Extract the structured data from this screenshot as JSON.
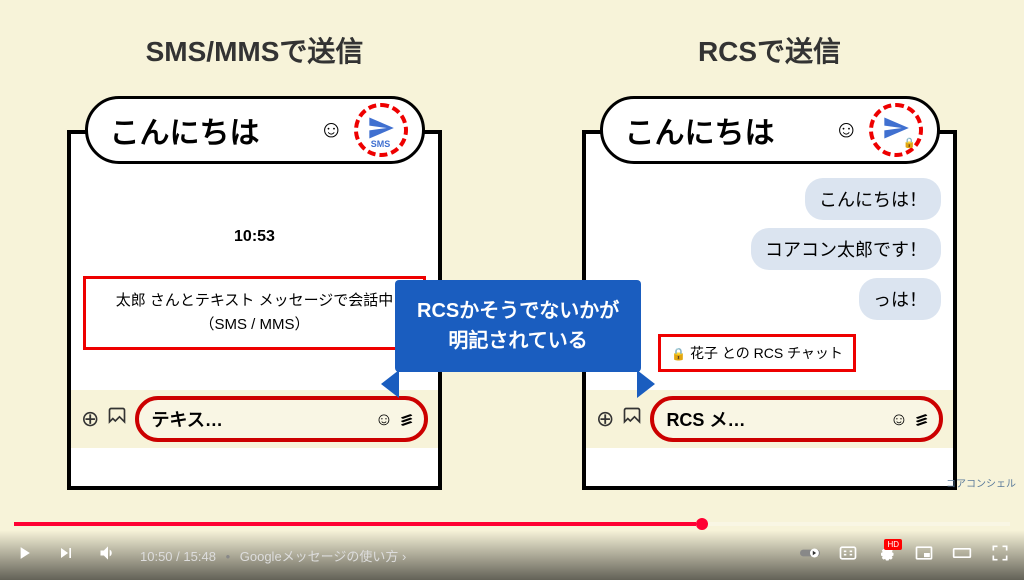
{
  "left": {
    "header": "SMS/MMSで送信",
    "inputText": "こんにちは",
    "sendLabel": "SMS",
    "timestamp": "10:53",
    "statusBox": "太郎 さんとテキスト メッセージで会話中（SMS / MMS）",
    "bottomInput": "テキス…"
  },
  "right": {
    "header": "RCSで送信",
    "inputText": "こんにちは",
    "msg1": "こんにちは！",
    "msg2": "コアコン太郎です！",
    "msg3": "っは！",
    "statusBox": "花子 との RCS チャット",
    "bottomInput": "RCS メ…"
  },
  "annotation": {
    "line1": "RCSかそうでないかが",
    "line2": "明記されている"
  },
  "watermark": "コアコンシェル",
  "player": {
    "currentTime": "10:50",
    "duration": "15:48",
    "chapter": "Googleメッセージの使い方",
    "hd": "HD"
  }
}
